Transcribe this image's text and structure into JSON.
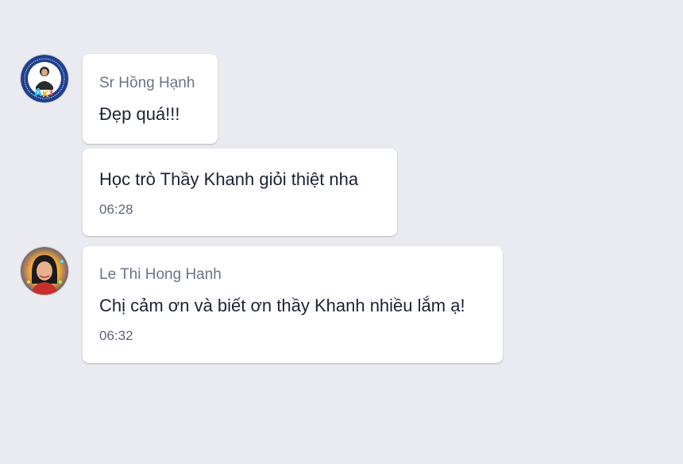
{
  "messages": [
    {
      "sender": "Sr Hồng Hạnh",
      "avatar": "avatar-badge-icon",
      "texts": [
        "Đẹp quá!!!",
        "Học trò Thầy Khanh giỏi thiệt nha"
      ],
      "time": "06:28"
    },
    {
      "sender": "Le Thi Hong Hanh",
      "avatar": "avatar-photo-icon",
      "texts": [
        "Chị cảm ơn và biết ơn thầy Khanh nhiều lắm ạ!"
      ],
      "time": "06:32"
    }
  ],
  "colors": {
    "background": "#e9ebf0",
    "bubble": "#ffffff",
    "sender": "#6b7385",
    "text": "#1c2233",
    "time": "#5d6577"
  }
}
